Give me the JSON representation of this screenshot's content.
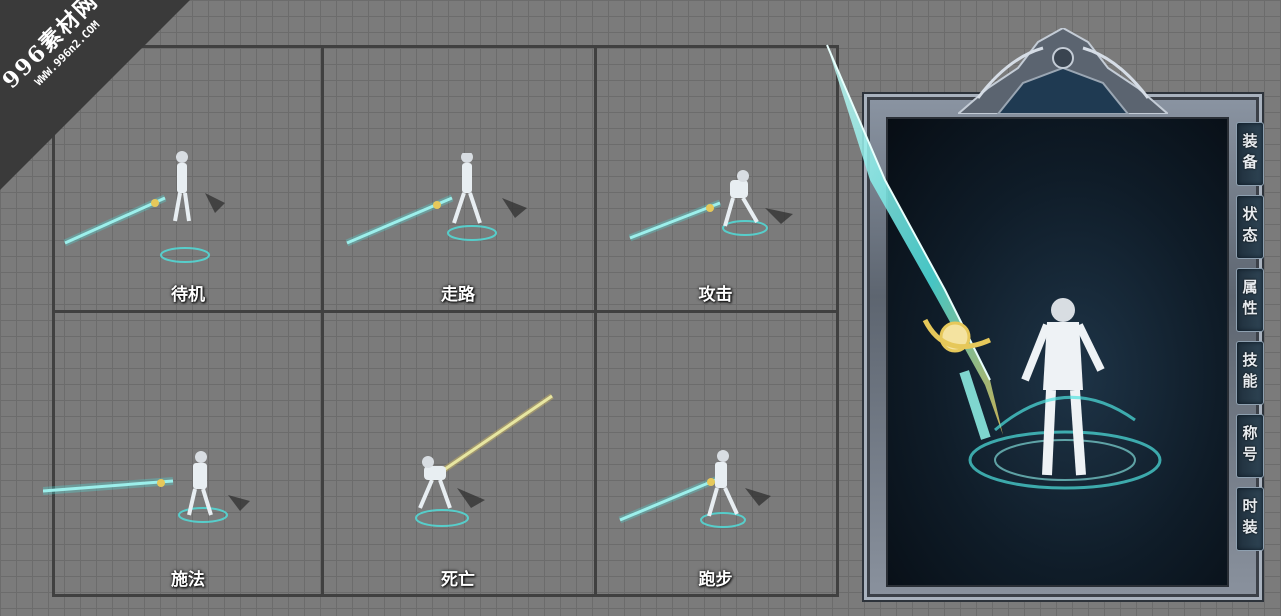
{
  "watermark": {
    "main": "996素材网",
    "url": "WWW.996n2.COM"
  },
  "actions": [
    {
      "id": "idle",
      "label": "待机"
    },
    {
      "id": "walk",
      "label": "走路"
    },
    {
      "id": "attack",
      "label": "攻击"
    },
    {
      "id": "cast",
      "label": "施法"
    },
    {
      "id": "death",
      "label": "死亡"
    },
    {
      "id": "run",
      "label": "跑步"
    }
  ],
  "equipment_panel": {
    "tabs": [
      "装备",
      "状态",
      "属性",
      "技能",
      "称号",
      "时装"
    ]
  },
  "colors": {
    "background": "#7b7b7b",
    "grid_line": "#404040",
    "panel_frame": "#5d6570",
    "viewport": "#0f1c28",
    "glow": "#4fe3e0",
    "gold": "#e6c85a"
  }
}
